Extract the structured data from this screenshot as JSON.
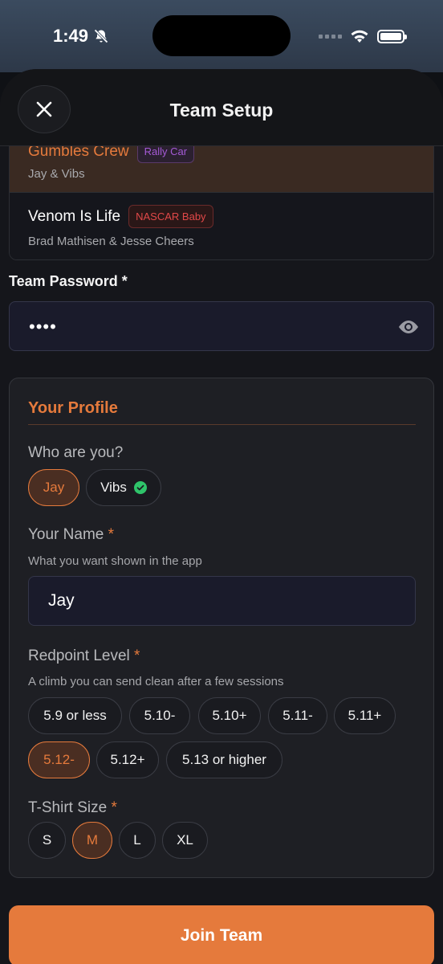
{
  "status": {
    "time": "1:49"
  },
  "header": {
    "title": "Team Setup"
  },
  "teams": [
    {
      "name": "Gumbles Crew",
      "tag": "Rally Car",
      "members": "Jay & Vibs",
      "selected": true
    },
    {
      "name": "Venom Is Life",
      "tag": "NASCAR Baby",
      "members": "Brad Mathisen & Jesse Cheers",
      "selected": false
    }
  ],
  "password": {
    "label": "Team Password *",
    "value": "••••"
  },
  "profile": {
    "title": "Your Profile",
    "who_label": "Who are you?",
    "who_options": [
      "Jay",
      "Vibs"
    ],
    "who_selected": "Jay",
    "name_label": "Your Name",
    "name_hint": "What you want shown in the app",
    "name_value": "Jay",
    "redpoint_label": "Redpoint Level",
    "redpoint_hint": "A climb you can send clean after a few sessions",
    "redpoint_options": [
      "5.9 or less",
      "5.10-",
      "5.10+",
      "5.11-",
      "5.11+",
      "5.12-",
      "5.12+",
      "5.13 or higher"
    ],
    "redpoint_selected": "5.12-",
    "shirt_label": "T-Shirt Size",
    "shirt_options": [
      "S",
      "M",
      "L",
      "XL"
    ],
    "shirt_selected": "M",
    "required_mark": "*"
  },
  "join_button": "Join Team",
  "colors": {
    "accent": "#e57a3c",
    "check": "#2fc46a"
  }
}
